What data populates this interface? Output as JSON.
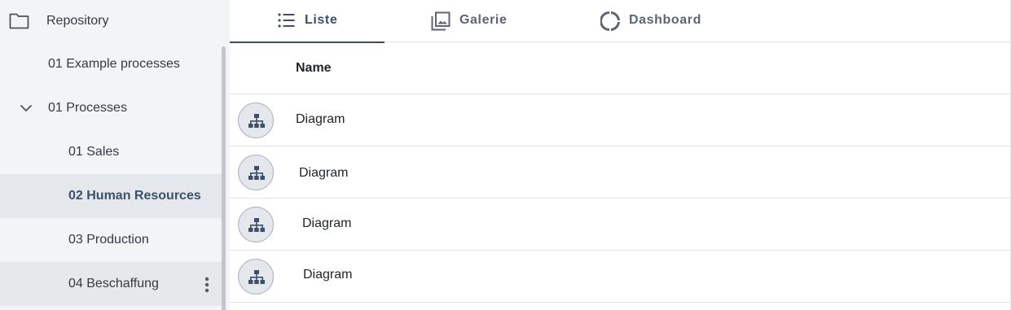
{
  "sidebar": {
    "root_label": "Repository",
    "items": [
      {
        "label": "01 Example processes"
      },
      {
        "label": "01 Processes"
      },
      {
        "label": "01 Sales"
      },
      {
        "label": "02 Human Resources"
      },
      {
        "label": "03 Production"
      },
      {
        "label": "04 Beschaffung"
      }
    ]
  },
  "tabs": [
    {
      "label": "Liste",
      "icon": "list-icon"
    },
    {
      "label": "Galerie",
      "icon": "gallery-icon"
    },
    {
      "label": "Dashboard",
      "icon": "donut-icon"
    }
  ],
  "table": {
    "column_name": "Name",
    "rows": [
      {
        "name": "Diagram",
        "icon": "org-chart-icon"
      },
      {
        "name": "Diagram",
        "icon": "org-chart-icon"
      },
      {
        "name": "Diagram",
        "icon": "org-chart-icon"
      },
      {
        "name": "Diagram",
        "icon": "org-chart-icon"
      }
    ]
  },
  "colors": {
    "accent": "#3d4c63",
    "sidebar_bg": "#f3f4f6",
    "selected_bg": "#e4e7eb"
  }
}
